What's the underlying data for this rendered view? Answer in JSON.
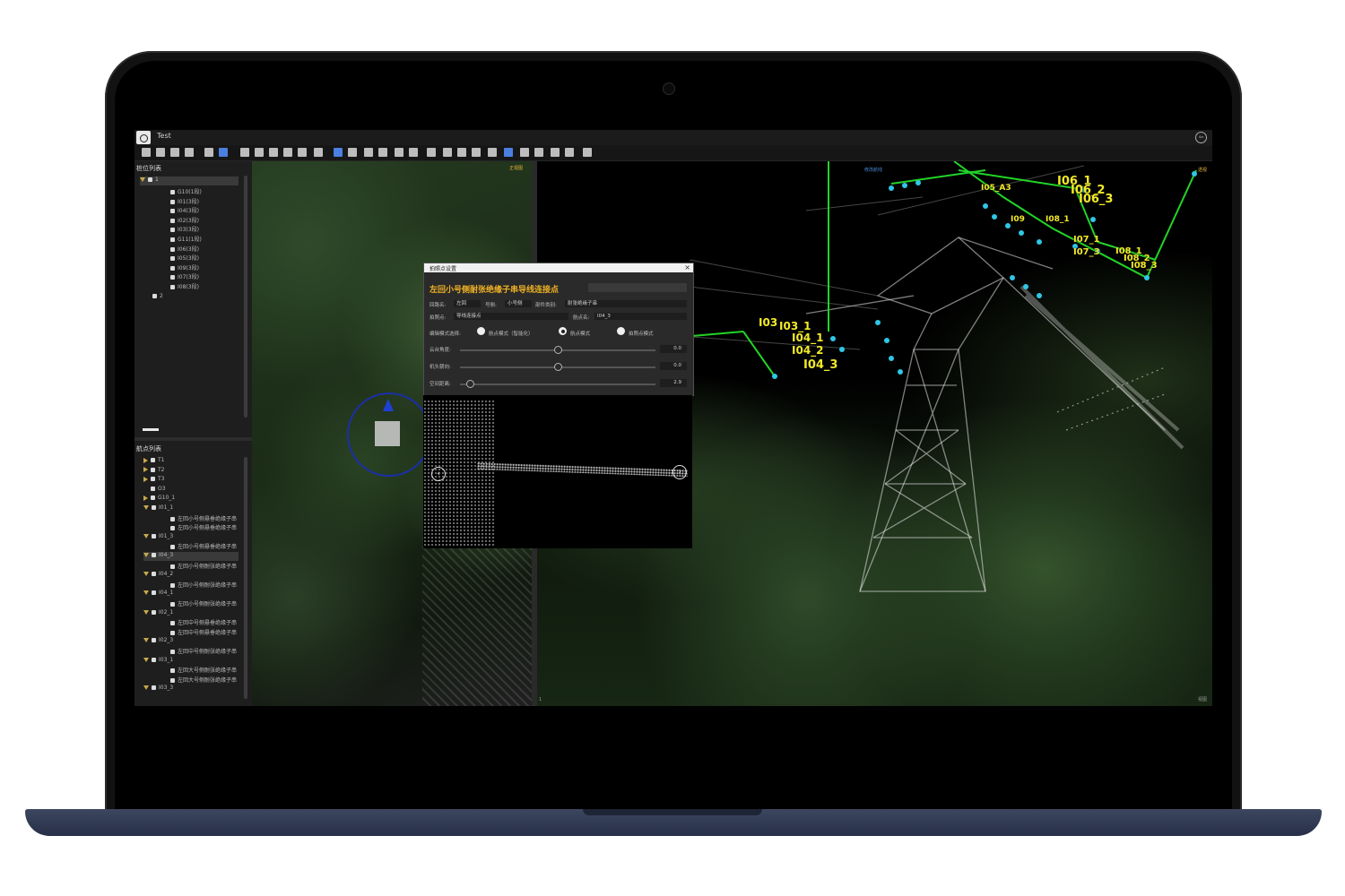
{
  "window": {
    "title": "Test"
  },
  "left_panel": {
    "tower_list_title": "桩位列表",
    "tower_root": "1",
    "tower_items": [
      "G10(1段)",
      "I01(3段)",
      "I04(3段)",
      "I02(3段)",
      "I03(3段)",
      "G11(1段)",
      "I06(3段)",
      "I05(3段)",
      "I09(3段)",
      "I07(3段)",
      "I08(3段)"
    ],
    "tower_root2": "2",
    "waypoint_list_title": "航点列表",
    "waypoint_items": [
      {
        "label": "T1",
        "depth": 0,
        "arrow": "right"
      },
      {
        "label": "T2",
        "depth": 0,
        "arrow": "right"
      },
      {
        "label": "T3",
        "depth": 0,
        "arrow": "right"
      },
      {
        "label": "O3",
        "depth": 0,
        "arrow": ""
      },
      {
        "label": "G10_1",
        "depth": 0,
        "arrow": "right"
      },
      {
        "label": "I01_1",
        "depth": 0,
        "arrow": "down"
      },
      {
        "label": "左回小号侧悬垂绝缘子串",
        "depth": 1,
        "arrow": ""
      },
      {
        "label": "左回小号侧悬垂绝缘子串",
        "depth": 1,
        "arrow": ""
      },
      {
        "label": "I01_3",
        "depth": 0,
        "arrow": "down"
      },
      {
        "label": "左回小号侧悬垂绝缘子串",
        "depth": 1,
        "arrow": ""
      },
      {
        "label": "I04_3",
        "depth": 0,
        "arrow": "down",
        "selected": true
      },
      {
        "label": "左回小号侧耐张绝缘子串",
        "depth": 1,
        "arrow": ""
      },
      {
        "label": "I04_2",
        "depth": 0,
        "arrow": "down"
      },
      {
        "label": "左回小号侧耐张绝缘子串",
        "depth": 1,
        "arrow": ""
      },
      {
        "label": "I04_1",
        "depth": 0,
        "arrow": "down"
      },
      {
        "label": "左回小号侧耐张绝缘子串",
        "depth": 1,
        "arrow": ""
      },
      {
        "label": "I02_1",
        "depth": 0,
        "arrow": "down"
      },
      {
        "label": "左回中号侧悬垂绝缘子串",
        "depth": 1,
        "arrow": ""
      },
      {
        "label": "左回中号侧悬垂绝缘子串",
        "depth": 1,
        "arrow": ""
      },
      {
        "label": "I02_3",
        "depth": 0,
        "arrow": "down"
      },
      {
        "label": "左回中号侧耐张绝缘子串",
        "depth": 1,
        "arrow": ""
      },
      {
        "label": "I03_1",
        "depth": 0,
        "arrow": "down"
      },
      {
        "label": "左回大号侧耐张绝缘子串",
        "depth": 1,
        "arrow": ""
      },
      {
        "label": "左回大号侧耐张绝缘子串",
        "depth": 1,
        "arrow": ""
      },
      {
        "label": "I03_3",
        "depth": 0,
        "arrow": "down"
      }
    ]
  },
  "viewport_left": {
    "tag": "正视图"
  },
  "viewport_right": {
    "tag_left": "修改航线",
    "tag_right": "透视",
    "corner_bottom_left": "1",
    "corner_bottom_right": "视图"
  },
  "point_labels": [
    "I05_A3",
    "I06_1",
    "I06_2",
    "I06_3",
    "I09",
    "I08_1",
    "I07_1",
    "I07_3",
    "I08_1",
    "I08_2",
    "I08_3",
    "I03",
    "I03_1",
    "I04_1",
    "I04_2",
    "I04_3"
  ],
  "dialog": {
    "title": "拍照点设置",
    "close": "×",
    "heading": "左回小号侧耐张绝缘子串导线连接点",
    "loop_label": "回路名:",
    "loop_value": "左回",
    "side_label": "号侧:",
    "side_value": "小号侧",
    "part_label": "部件类别:",
    "part_value": "耐张绝缘子串",
    "photo_label": "拍照点:",
    "photo_value": "导线连接点",
    "waypoint_label": "航点名:",
    "waypoint_value": "I04_3",
    "mode_label": "编辑模式选择:",
    "mode_options": [
      "航点模式（智能化）",
      "航点模式",
      "拍照点模式"
    ],
    "gimbal_label": "云台角度:",
    "gimbal_value": "0.0",
    "heading_dir_label": "机头朝向:",
    "heading_dir_value": "0.0",
    "distance_label": "空间距离:",
    "distance_value": "2.9",
    "slider_levels": [
      0.5,
      0.5,
      0.05
    ]
  },
  "colors": {
    "accent": "#f0b224",
    "label_yellow": "#f2ea2a",
    "route_green": "#22d427",
    "point_cyan": "#2fc7e6",
    "laptop_base": "#2f3851"
  }
}
